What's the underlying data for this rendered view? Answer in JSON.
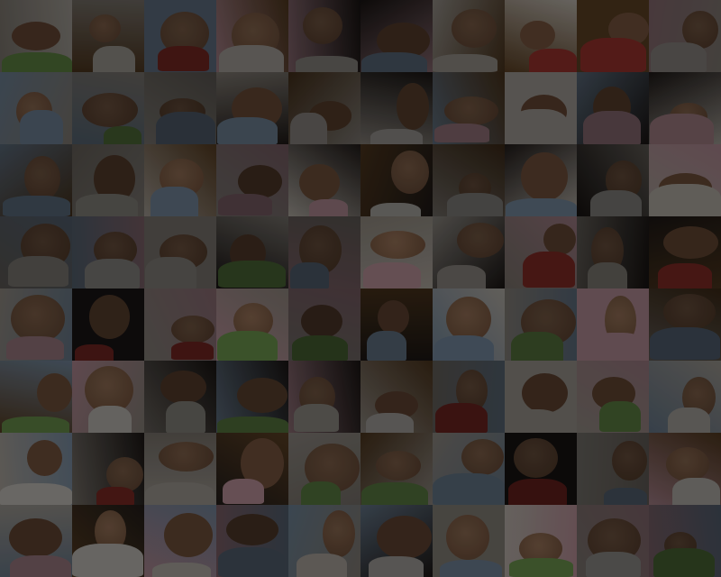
{
  "image": {
    "description_kind": "photo-mosaic",
    "rows": 8,
    "cols": 10,
    "dim": true,
    "palette": {
      "skin": "#b58a6a",
      "skin_dark": "#8a6248",
      "blanket_light": "#d9d2c8",
      "blanket_pink": "#d7a7b2",
      "blanket_blue": "#8ea6bf",
      "dark_bg": "#2a2320",
      "wood": "#6b4b2a",
      "red": "#b13b35",
      "green": "#7fae5b"
    }
  }
}
